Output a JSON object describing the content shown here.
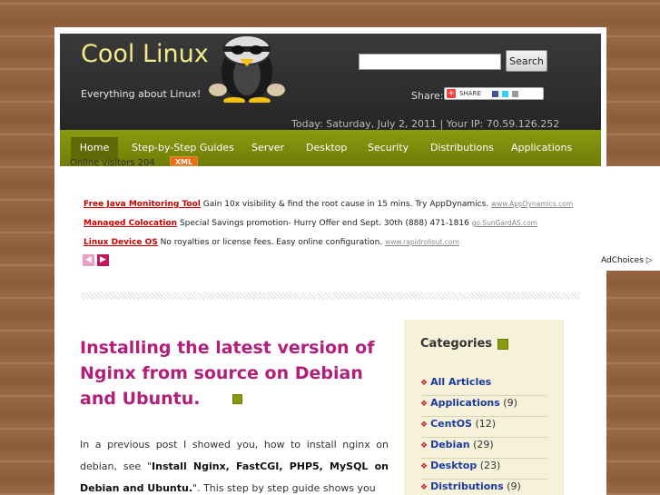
{
  "site": {
    "title": "Cool Linux",
    "tagline": "Everything about Linux!",
    "today": "Today: Saturday, July 2, 2011 | Your IP: 70.59.126.252"
  },
  "search": {
    "button_label": "Search",
    "value": ""
  },
  "share": {
    "label": "Share:",
    "button_text": "SHARE"
  },
  "nav": {
    "items": [
      {
        "label": "Home"
      },
      {
        "label": "Step-by-Step Guides"
      },
      {
        "label": "Server"
      },
      {
        "label": "Desktop"
      },
      {
        "label": "Security"
      },
      {
        "label": "Distributions"
      },
      {
        "label": "Applications"
      }
    ]
  },
  "visitors": "Online visitors 204",
  "xml_badge": "XML",
  "ads": [
    {
      "title": "Free Java Monitoring Tool",
      "text": " Gain 10x visibility & find the root cause in 15 mins. Try AppDynamics. ",
      "url": "www.AppDynamics.com"
    },
    {
      "title": "Managed Colocation",
      "text": " Special Savings promotion- Hurry Offer end Sept. 30th (888) 471-1816 ",
      "url": "go.SunGardAS.com"
    },
    {
      "title": "Linux Device OS",
      "text": " No royalties or license fees. Easy online configuration. ",
      "url": "www.rapidrollout.com"
    }
  ],
  "adchoices": "AdChoices",
  "post": {
    "title": "Installing the latest version of Nginx from source on Debian and Ubuntu.",
    "body_1": "In a previous post I showed you, how to install nginx on debian, see \"",
    "body_bold_1": "Install Nginx, FastCGI, PHP5, MySQL on Debian and Ubuntu.",
    "body_2": "\". This step by step guide shows you"
  },
  "sidebar": {
    "heading": "Categories",
    "categories": [
      {
        "name": "All Articles",
        "count": ""
      },
      {
        "name": "Applications",
        "count": "(9)"
      },
      {
        "name": "CentOS",
        "count": "(12)"
      },
      {
        "name": "Debian",
        "count": "(29)"
      },
      {
        "name": "Desktop",
        "count": "(23)"
      },
      {
        "name": "Distributions",
        "count": "(9)"
      }
    ]
  },
  "colors": {
    "accent_olive": "#7a8a0c",
    "title_pink": "#b0207a",
    "logo_yellow": "#f0ea8a",
    "link_blue": "#1a3aa0",
    "ad_red": "#cc0000"
  }
}
